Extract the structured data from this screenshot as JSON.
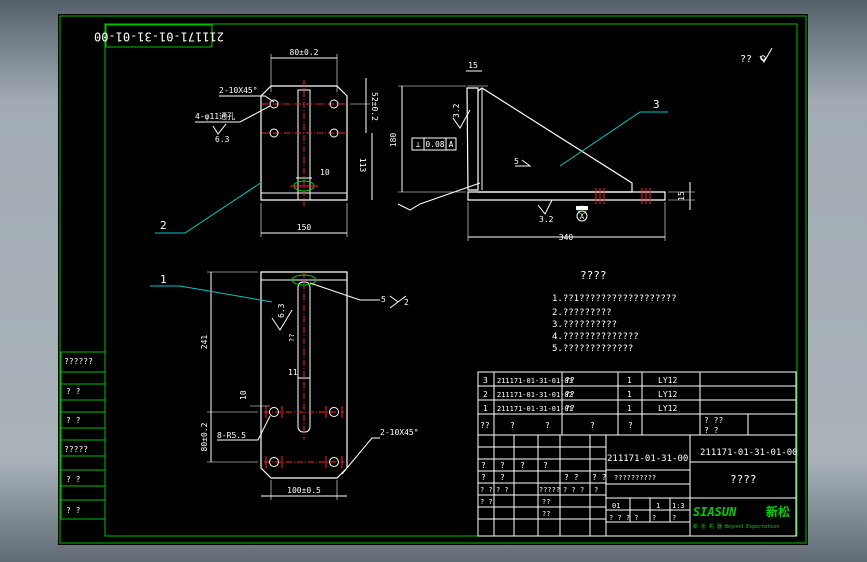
{
  "colors": {
    "paper": "#000000",
    "border": "#00c000",
    "white": "#ffffff",
    "cyan": "#00c8c8",
    "red": "#ff2020",
    "green": "#00d000"
  },
  "drawing_number_rotated": "211171-01-31-01-00",
  "surface_symbol_text": "?? ",
  "dims": {
    "d80": "80±0.2",
    "d52": "52±0.2",
    "d113": "113",
    "d150": "150",
    "chamfer_top": "2-10X45°",
    "holes_top": "4-φ11通孔",
    "r63": "6.3",
    "d10": "10",
    "d15a": "15",
    "d180": "180",
    "d32a": "3.2",
    "tol_flat": "0.08",
    "datum_a": "A",
    "weld5": "5",
    "d340": "340",
    "d32b": "3.2",
    "d15b": "15",
    "datum_circle": "A",
    "d241": "241",
    "weld_bottom": "5",
    "weld_bottom2": "2",
    "r63b": "6.3",
    "q22": "??",
    "d11": "11",
    "d10b": "10",
    "holes_bottom": "8-R5.5",
    "d80b": "80±0.2",
    "chamfer_bottom": "2-10X45°",
    "d100": "100±0.5"
  },
  "leaders": {
    "l1": "1",
    "l2": "2",
    "l3": "3"
  },
  "notes": {
    "title": "????",
    "lines": [
      "1.??1??????????????????",
      "2.?????????",
      "3.??????????",
      "4.??????????????",
      "5.?????????????"
    ]
  },
  "left_strip": [
    "??????",
    "?   ?",
    "?   ?",
    "?????",
    "?   ?",
    "?   ?"
  ],
  "bom": [
    {
      "no": "3",
      "code": "211171-01-31-01-03",
      "name": "??",
      "qty": "1",
      "mat": "LY12"
    },
    {
      "no": "2",
      "code": "211171-01-31-01-02",
      "name": "??",
      "qty": "1",
      "mat": "LY12"
    },
    {
      "no": "1",
      "code": "211171-01-31-01-01",
      "name": "??",
      "qty": "1",
      "mat": "LY12"
    }
  ],
  "bom_header": {
    "c1": "??",
    "c2": "?",
    "c3": "?",
    "c4": "?",
    "c5": "?",
    "c6": "? ??",
    "c7": "? ?"
  },
  "title_block": {
    "code_left": "211171-01-31-00",
    "code_right": "211171-01-31-01-00",
    "name_right": "????",
    "small_q": "??????????",
    "row_a": [
      "?",
      "?",
      "?",
      "?"
    ],
    "row_b": [
      "?",
      "?",
      "? ?",
      "? ?"
    ],
    "row_c": [
      "? ?",
      "? ?",
      "?????",
      "? ?",
      "?",
      "?"
    ],
    "row_d": [
      "? ?"
    ],
    "row_e": [
      "??",
      "??"
    ],
    "scale_row": [
      "01",
      "1",
      "1:3"
    ],
    "sheet_row": [
      "? ? ? ?",
      "?",
      "?"
    ],
    "brand": "SIASUN",
    "brand_cn": "新松",
    "brand_sub": "新 松 机 器   Beyond Expectation"
  }
}
